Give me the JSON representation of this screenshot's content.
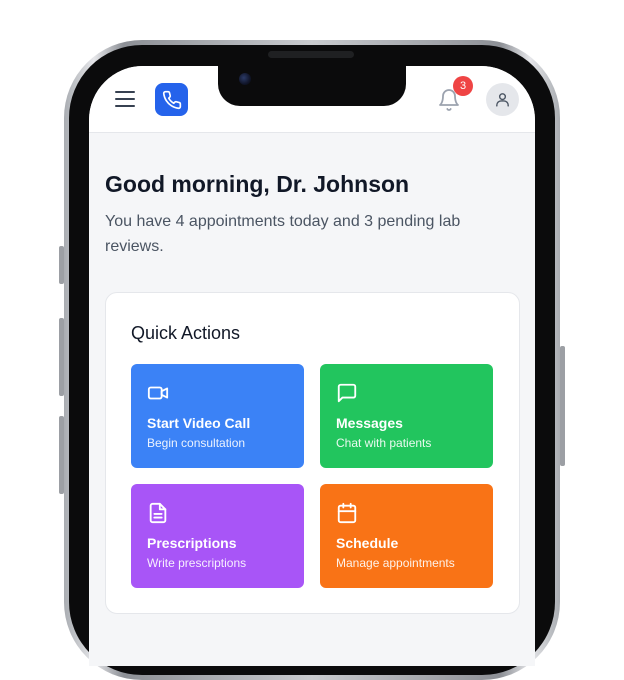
{
  "header": {
    "notification_count": "3"
  },
  "greeting": {
    "title": "Good morning, Dr. Johnson",
    "summary": "You have 4 appointments today and 3 pending lab reviews."
  },
  "quick_actions": {
    "title": "Quick Actions",
    "items": [
      {
        "label": "Start Video Call",
        "sub": "Begin consultation",
        "icon": "video-camera-icon",
        "color": "#3b82f6"
      },
      {
        "label": "Messages",
        "sub": "Chat with patients",
        "icon": "chat-bubble-icon",
        "color": "#22c55e"
      },
      {
        "label": "Prescriptions",
        "sub": "Write prescriptions",
        "icon": "document-icon",
        "color": "#a855f7"
      },
      {
        "label": "Schedule",
        "sub": "Manage appointments",
        "icon": "calendar-icon",
        "color": "#f97316"
      }
    ]
  },
  "colors": {
    "brand": "#2563eb",
    "badge": "#ef4444"
  }
}
